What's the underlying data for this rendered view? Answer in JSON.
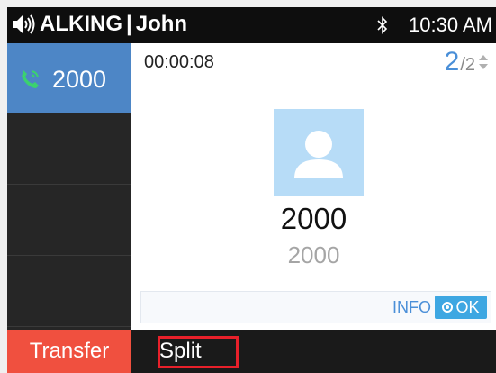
{
  "status_bar": {
    "state_label": "ALKING",
    "separator": "|",
    "account_name": "John",
    "time": "10:30 AM",
    "icons": [
      "speaker-icon",
      "bluetooth-icon"
    ]
  },
  "lines": [
    {
      "label": "2000",
      "icon": "phone-call-icon",
      "active": true
    },
    {
      "label": ""
    },
    {
      "label": ""
    },
    {
      "label": ""
    }
  ],
  "call": {
    "duration": "00:00:08",
    "current_index": "2",
    "total": "2",
    "caller_name": "2000",
    "caller_number": "2000",
    "info_label": "INFO",
    "ok_label": "OK"
  },
  "softkeys": {
    "transfer": "Transfer",
    "split": "Split"
  },
  "colors": {
    "active_line": "#4d86c6",
    "accent": "#4a8fd8",
    "transfer": "#f0503f",
    "highlight": "#e8202a",
    "avatar_bg": "#b7dcf7"
  }
}
